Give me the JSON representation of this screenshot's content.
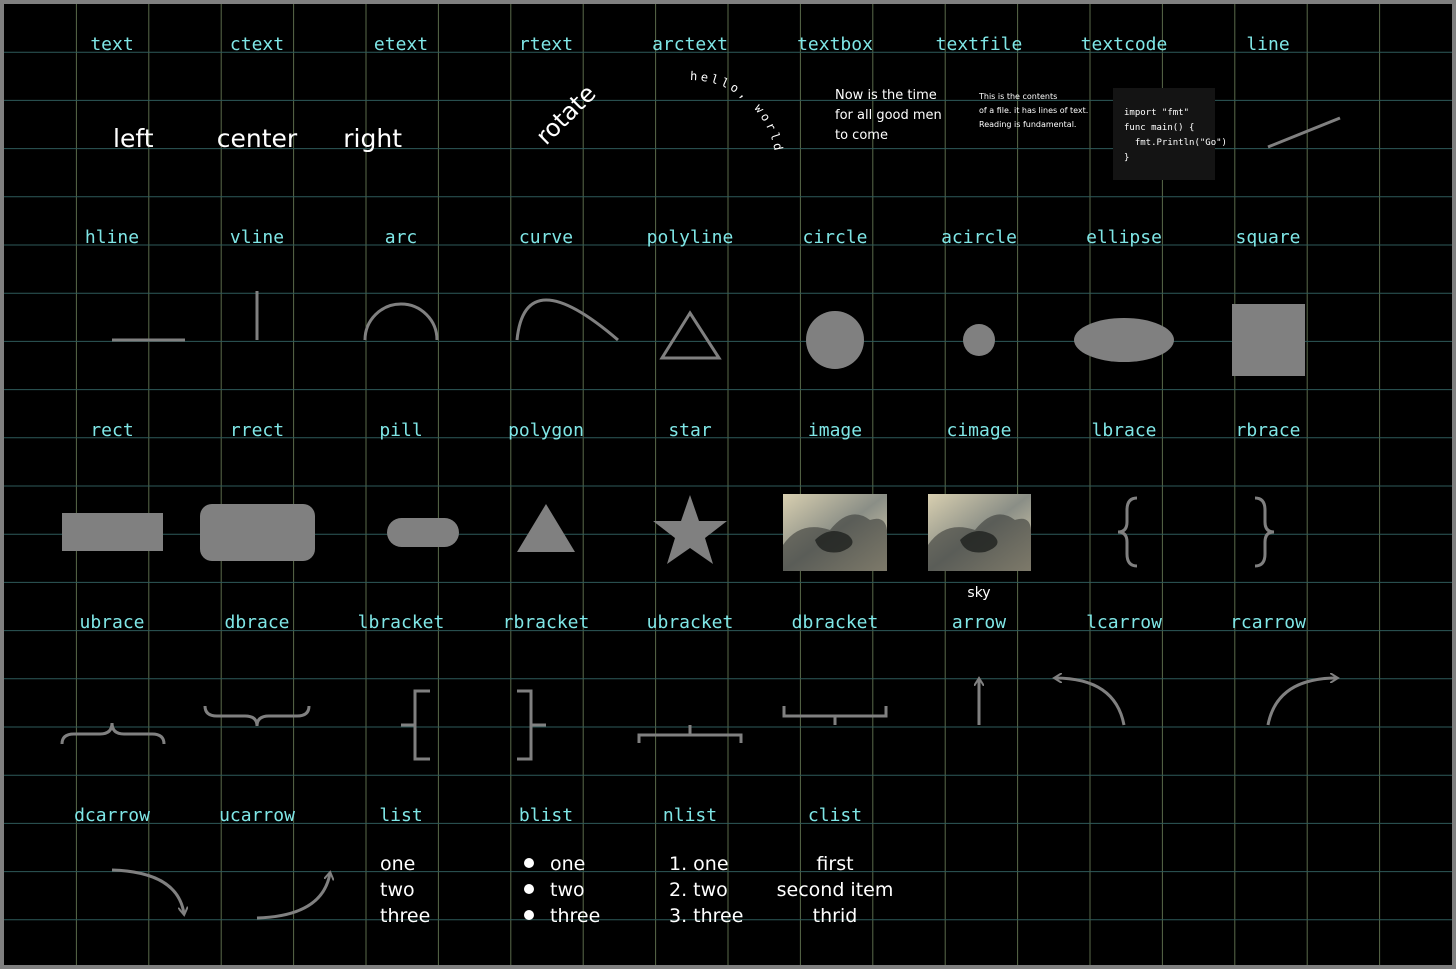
{
  "colors": {
    "background": "#000000",
    "frame": "#808080",
    "label": "#7fe6e6",
    "shape": "#808080",
    "text": "#ffffff",
    "grid_v": "#5a6a4a",
    "grid_h": "#2e5a5a"
  },
  "labels": {
    "text": "text",
    "ctext": "ctext",
    "etext": "etext",
    "rtext": "rtext",
    "arctext": "arctext",
    "textbox": "textbox",
    "textfile": "textfile",
    "textcode": "textcode",
    "line": "line",
    "hline": "hline",
    "vline": "vline",
    "arc": "arc",
    "curve": "curve",
    "polyline": "polyline",
    "circle": "circle",
    "acircle": "acircle",
    "ellipse": "ellipse",
    "square": "square",
    "rect": "rect",
    "rrect": "rrect",
    "pill": "pill",
    "polygon": "polygon",
    "star": "star",
    "image": "image",
    "cimage": "cimage",
    "lbrace": "lbrace",
    "rbrace": "rbrace",
    "ubrace": "ubrace",
    "dbrace": "dbrace",
    "lbracket": "lbracket",
    "rbracket": "rbracket",
    "ubracket": "ubracket",
    "dbracket": "dbracket",
    "arrow": "arrow",
    "lcarrow": "lcarrow",
    "rcarrow": "rcarrow",
    "dcarrow": "dcarrow",
    "ucarrow": "ucarrow",
    "list": "list",
    "blist": "blist",
    "nlist": "nlist",
    "clist": "clist"
  },
  "demos": {
    "left": "left",
    "center": "center",
    "right": "right",
    "rotate": "rotate",
    "arc_text": "hello, world",
    "textbox_lines": [
      "Now is the time",
      "for all good men",
      "to come"
    ],
    "textfile_lines": [
      "This is the contents",
      "of a file. it has lines of text.",
      "Reading is fundamental."
    ],
    "code_lines": [
      "import \"fmt\"",
      "func main() {",
      "  fmt.Println(\"Go\")",
      "}"
    ],
    "cimage_caption": "sky",
    "list_items": [
      "one",
      "two",
      "three"
    ],
    "blist_items": [
      "one",
      "two",
      "three"
    ],
    "nlist_items": [
      "1. one",
      "2. two",
      "3. three"
    ],
    "clist_items": [
      "first",
      "second item",
      "thrid"
    ]
  }
}
